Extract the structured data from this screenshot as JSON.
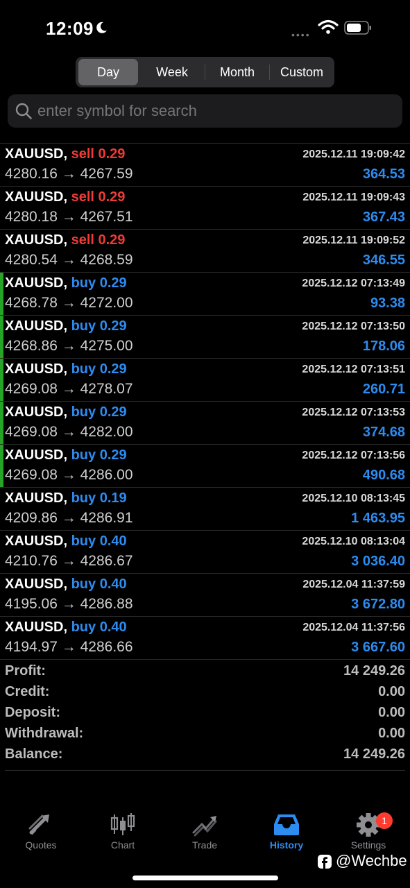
{
  "status_bar": {
    "time": "12:09"
  },
  "tabs": [
    "Day",
    "Week",
    "Month",
    "Custom"
  ],
  "search": {
    "placeholder": "enter symbol for search"
  },
  "trades": [
    {
      "symbol": "XAUUSD,",
      "side": "sell",
      "volume": "0.29",
      "open": "4280.16",
      "close": "4267.59",
      "arrow": "→",
      "datetime": "2025.12.11 19:09:42",
      "profit": "364.53",
      "marker": false
    },
    {
      "symbol": "XAUUSD,",
      "side": "sell",
      "volume": "0.29",
      "open": "4280.18",
      "close": "4267.51",
      "arrow": "→",
      "datetime": "2025.12.11 19:09:43",
      "profit": "367.43",
      "marker": false
    },
    {
      "symbol": "XAUUSD,",
      "side": "sell",
      "volume": "0.29",
      "open": "4280.54",
      "close": "4268.59",
      "arrow": "→",
      "datetime": "2025.12.11 19:09:52",
      "profit": "346.55",
      "marker": false
    },
    {
      "symbol": "XAUUSD,",
      "side": "buy",
      "volume": "0.29",
      "open": "4268.78",
      "close": "4272.00",
      "arrow": "→",
      "datetime": "2025.12.12 07:13:49",
      "profit": "93.38",
      "marker": true
    },
    {
      "symbol": "XAUUSD,",
      "side": "buy",
      "volume": "0.29",
      "open": "4268.86",
      "close": "4275.00",
      "arrow": "→",
      "datetime": "2025.12.12 07:13:50",
      "profit": "178.06",
      "marker": true
    },
    {
      "symbol": "XAUUSD,",
      "side": "buy",
      "volume": "0.29",
      "open": "4269.08",
      "close": "4278.07",
      "arrow": "→",
      "datetime": "2025.12.12 07:13:51",
      "profit": "260.71",
      "marker": true
    },
    {
      "symbol": "XAUUSD,",
      "side": "buy",
      "volume": "0.29",
      "open": "4269.08",
      "close": "4282.00",
      "arrow": "→",
      "datetime": "2025.12.12 07:13:53",
      "profit": "374.68",
      "marker": true
    },
    {
      "symbol": "XAUUSD,",
      "side": "buy",
      "volume": "0.29",
      "open": "4269.08",
      "close": "4286.00",
      "arrow": "→",
      "datetime": "2025.12.12 07:13:56",
      "profit": "490.68",
      "marker": true
    },
    {
      "symbol": "XAUUSD,",
      "side": "buy",
      "volume": "0.19",
      "open": "4209.86",
      "close": "4286.91",
      "arrow": "→",
      "datetime": "2025.12.10 08:13:45",
      "profit": "1 463.95",
      "marker": false
    },
    {
      "symbol": "XAUUSD,",
      "side": "buy",
      "volume": "0.40",
      "open": "4210.76",
      "close": "4286.67",
      "arrow": "→",
      "datetime": "2025.12.10 08:13:04",
      "profit": "3 036.40",
      "marker": false
    },
    {
      "symbol": "XAUUSD,",
      "side": "buy",
      "volume": "0.40",
      "open": "4195.06",
      "close": "4286.88",
      "arrow": "→",
      "datetime": "2025.12.04 11:37:59",
      "profit": "3 672.80",
      "marker": false
    },
    {
      "symbol": "XAUUSD,",
      "side": "buy",
      "volume": "0.40",
      "open": "4194.97",
      "close": "4286.66",
      "arrow": "→",
      "datetime": "2025.12.04 11:37:56",
      "profit": "3 667.60",
      "marker": false
    }
  ],
  "summary": [
    {
      "label": "Profit:",
      "value": "14 249.26"
    },
    {
      "label": "Credit:",
      "value": "0.00"
    },
    {
      "label": "Deposit:",
      "value": "0.00"
    },
    {
      "label": "Withdrawal:",
      "value": "0.00"
    },
    {
      "label": "Balance:",
      "value": "14 249.26"
    }
  ],
  "nav": {
    "items": [
      {
        "label": "Quotes",
        "icon": "quotes-arrows-icon"
      },
      {
        "label": "Chart",
        "icon": "candlestick-chart-icon"
      },
      {
        "label": "Trade",
        "icon": "trade-trend-icon"
      },
      {
        "label": "History",
        "icon": "history-inbox-icon"
      },
      {
        "label": "Settings",
        "icon": "gear-icon"
      }
    ],
    "active": "History",
    "settings_badge": "1"
  },
  "watermark": "@Wechbe",
  "colors": {
    "sell": "#ef3b35",
    "buy": "#2d8cf0",
    "profit": "#2d8cf0",
    "active_tab": "#2d8cf0",
    "marker": "#27a327",
    "badge": "#ff3b30"
  }
}
